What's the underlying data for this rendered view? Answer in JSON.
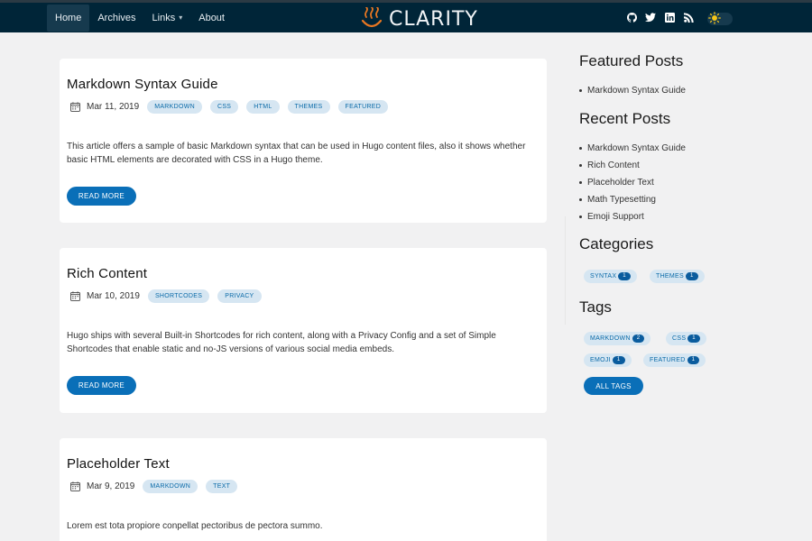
{
  "nav": {
    "items": [
      {
        "label": "Home"
      },
      {
        "label": "Archives"
      },
      {
        "label": "Links"
      },
      {
        "label": "About"
      }
    ]
  },
  "brand": {
    "title": "CLARITY",
    "logo_icon": "hot-spring-icon",
    "accent": "#e87722"
  },
  "social": [
    {
      "icon": "github-icon"
    },
    {
      "icon": "twitter-icon"
    },
    {
      "icon": "linkedin-icon"
    },
    {
      "icon": "rss-icon"
    }
  ],
  "theme_toggle": {
    "icon": "sun-icon"
  },
  "posts": [
    {
      "title": "Markdown Syntax Guide",
      "date": "Mar 11, 2019",
      "tags": [
        "MARKDOWN",
        "CSS",
        "HTML",
        "THEMES",
        "FEATURED"
      ],
      "excerpt": "This article offers a sample of basic Markdown syntax that can be used in Hugo content files, also it shows whether basic HTML elements are decorated with CSS in a Hugo theme.",
      "read_more": "READ MORE"
    },
    {
      "title": "Rich Content",
      "date": "Mar 10, 2019",
      "tags": [
        "SHORTCODES",
        "PRIVACY"
      ],
      "excerpt": "Hugo ships with several Built-in Shortcodes for rich content, along with a Privacy Config and a set of Simple Shortcodes that enable static and no-JS versions of various social media embeds.",
      "read_more": "READ MORE"
    },
    {
      "title": "Placeholder Text",
      "date": "Mar 9, 2019",
      "tags": [
        "MARKDOWN",
        "TEXT"
      ],
      "excerpt": "Lorem est tota propiore conpellat pectoribus de pectora summo."
    }
  ],
  "sidebar": {
    "featured": {
      "heading": "Featured Posts",
      "items": [
        "Markdown Syntax Guide"
      ]
    },
    "recent": {
      "heading": "Recent Posts",
      "items": [
        "Markdown Syntax Guide",
        "Rich Content",
        "Placeholder Text",
        "Math Typesetting",
        "Emoji Support"
      ]
    },
    "categories": {
      "heading": "Categories",
      "items": [
        {
          "label": "SYNTAX",
          "count": "1"
        },
        {
          "label": "THEMES",
          "count": "1"
        }
      ]
    },
    "tags": {
      "heading": "Tags",
      "items": [
        {
          "label": "MARKDOWN",
          "count": "2"
        },
        {
          "label": "CSS",
          "count": "1"
        },
        {
          "label": "EMOJI",
          "count": "1"
        },
        {
          "label": "FEATURED",
          "count": "1"
        }
      ],
      "all_label": "ALL TAGS"
    }
  },
  "colors": {
    "header_bg": "#002538",
    "button": "#0a6fb8",
    "tag_bg": "#d6e6f2",
    "tag_text": "#0a6aa8"
  }
}
